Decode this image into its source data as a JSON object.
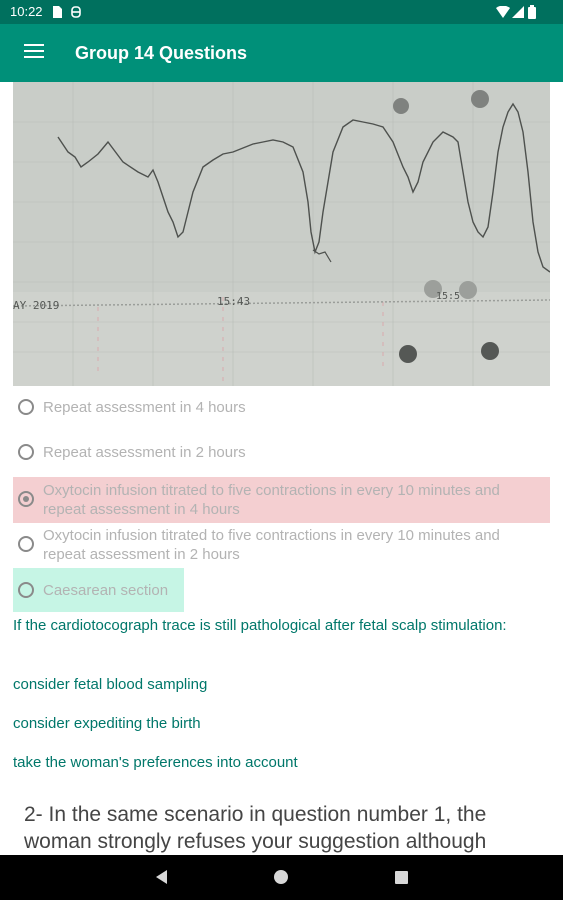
{
  "status": {
    "time": "10:22",
    "icons": [
      "sim-icon",
      "sync-icon",
      "wifi-icon",
      "signal-icon",
      "battery-icon"
    ]
  },
  "appbar": {
    "title": "Group 14 Questions",
    "menu_icon": "hamburger-menu-icon"
  },
  "ctg_image": {
    "labels": [
      "AY 2019",
      "15:43",
      "15:5"
    ]
  },
  "options": [
    {
      "label": "Repeat assessment in 4 hours",
      "state": "unselected"
    },
    {
      "label": "Repeat assessment in 2 hours",
      "state": "unselected"
    },
    {
      "label": "Oxytocin infusion titrated to five contractions in every 10 minutes and repeat assessment in 4 hours",
      "state": "selected-wrong"
    },
    {
      "label": "Oxytocin infusion titrated to five contractions in every 10 minutes and repeat assessment in 2 hours",
      "state": "unselected"
    },
    {
      "label": "Caesarean section",
      "state": "correct"
    }
  ],
  "explanation": {
    "intro": "If the cardiotocograph trace is still pathological after fetal scalp stimulation:",
    "points": [
      "consider fetal blood sampling",
      "consider expediting the birth",
      "take the woman's preferences into account"
    ]
  },
  "next_question": "2- In the same scenario in question number 1, the woman strongly refuses your suggestion although",
  "colors": {
    "status_bar": "#00705e",
    "app_bar": "#009079",
    "wrong_highlight": "#f4cfd1",
    "correct_highlight": "#c6f5e5",
    "explanation_text": "#00776a"
  },
  "navbar": {
    "icons": [
      "back-icon",
      "home-icon",
      "recents-icon"
    ]
  }
}
